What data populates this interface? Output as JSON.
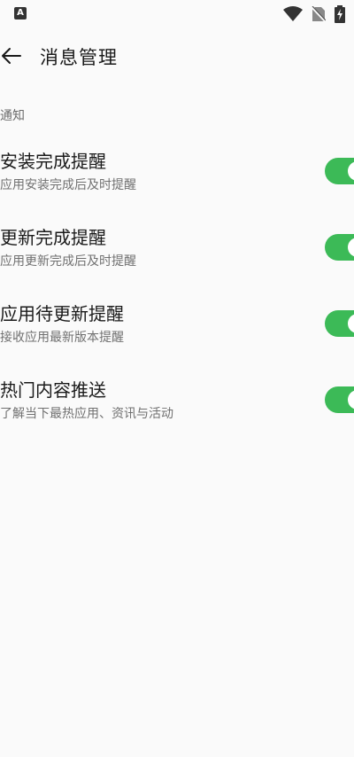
{
  "status_bar": {
    "left_icon": "A",
    "icons": [
      "wifi-icon",
      "no-sim-icon",
      "battery-charging-icon"
    ]
  },
  "app_bar": {
    "back_icon": "arrow-left-icon",
    "title": "消息管理"
  },
  "section": {
    "header": "通知"
  },
  "settings": [
    {
      "title": "安装完成提醒",
      "desc": "应用安装完成后及时提醒",
      "enabled": true
    },
    {
      "title": "更新完成提醒",
      "desc": "应用更新完成后及时提醒",
      "enabled": true
    },
    {
      "title": "应用待更新提醒",
      "desc": "接收应用最新版本提醒",
      "enabled": true
    },
    {
      "title": "热门内容推送",
      "desc": "了解当下最热应用、资讯与活动",
      "enabled": true
    }
  ],
  "colors": {
    "toggle_on": "#3cba57",
    "background": "#fafafa"
  }
}
